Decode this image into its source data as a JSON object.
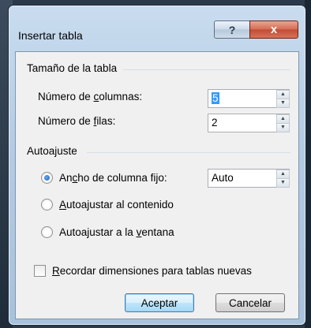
{
  "window": {
    "title": "Insertar tabla",
    "help_button": "?",
    "close_button": "x"
  },
  "table_size": {
    "group_label": "Tamaño de la tabla",
    "columns": {
      "label_pre": "Número de ",
      "label_key": "c",
      "label_post": "olumnas:",
      "value": "5"
    },
    "rows": {
      "label_pre": "Número de ",
      "label_key": "f",
      "label_post": "ilas:",
      "value": "2"
    }
  },
  "autofit": {
    "group_label": "Autoajuste",
    "fixed": {
      "label_pre": "An",
      "label_key": "c",
      "label_post": "ho de columna fijo:",
      "value": "Auto",
      "checked": true
    },
    "contents": {
      "label_pre": "",
      "label_key": "A",
      "label_post": "utoajustar al contenido",
      "checked": false
    },
    "window": {
      "label_pre": "Autoajustar a la ",
      "label_key": "v",
      "label_post": "entana",
      "checked": false
    }
  },
  "remember": {
    "label_pre": "",
    "label_key": "R",
    "label_post": "ecordar dimensiones para tablas nuevas",
    "checked": false
  },
  "buttons": {
    "ok": "Aceptar",
    "cancel": "Cancelar"
  }
}
